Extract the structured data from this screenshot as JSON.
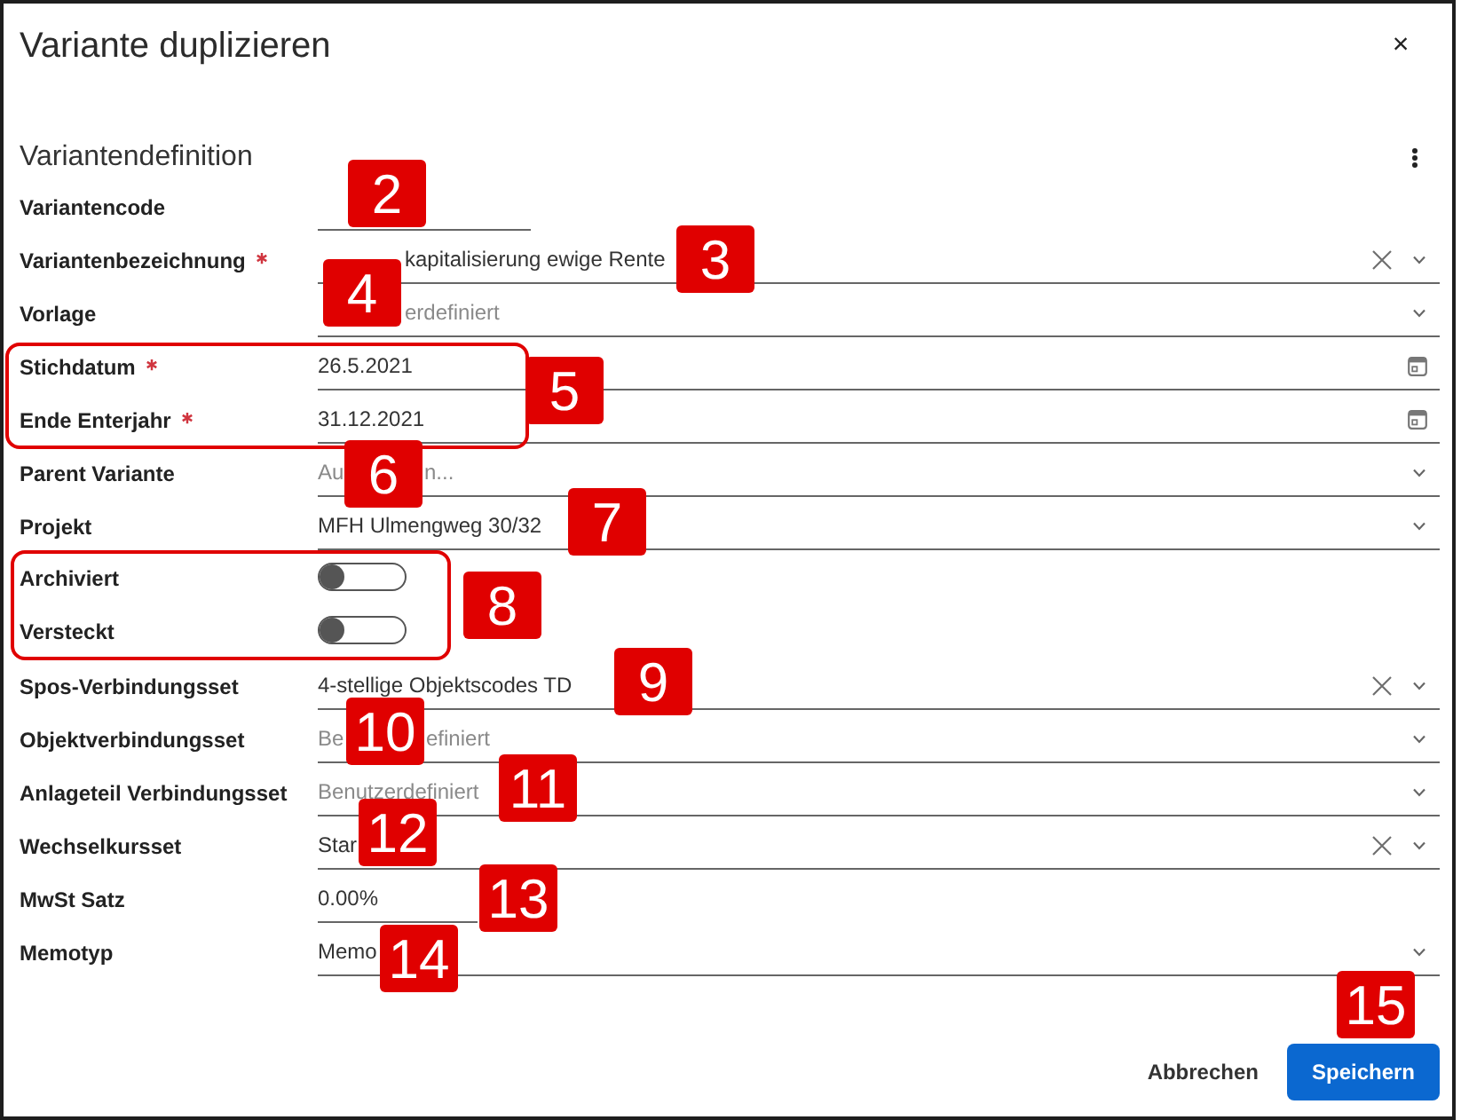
{
  "dialog": {
    "title": "Variante duplizieren",
    "close": "×"
  },
  "section": {
    "title": "Variantendefinition"
  },
  "fields": [
    {
      "kind": "short_input",
      "label": "Variantencode",
      "required": false
    },
    {
      "kind": "select",
      "label": "Variantenbezeichnung",
      "required": true,
      "value": "kapitalisierung ewige Rente",
      "clearable": true
    },
    {
      "kind": "select",
      "label": "Vorlage",
      "required": false,
      "placeholder": "erdefiniert",
      "clearable": false
    },
    {
      "kind": "group",
      "highlighted": true,
      "fields": [
        {
          "kind": "date",
          "label": "Stichdatum",
          "required": true,
          "value": "26.5.2021"
        },
        {
          "kind": "date",
          "label": "Ende Enterjahr",
          "required": true,
          "value": "31.12.2021"
        }
      ]
    },
    {
      "kind": "select",
      "label": "Parent Variante",
      "required": false,
      "placeholder": "Au",
      "placeholder_tail": "n...",
      "clearable": false
    },
    {
      "kind": "select",
      "label": "Projekt",
      "required": false,
      "value": "MFH Ulmengweg 30/32",
      "clearable": false
    },
    {
      "kind": "group",
      "highlighted": true,
      "fields": [
        {
          "kind": "toggle",
          "label": "Archiviert",
          "on": false
        },
        {
          "kind": "toggle",
          "label": "Versteckt",
          "on": false
        }
      ]
    },
    {
      "kind": "select",
      "label": "Spos-Verbindungsset",
      "required": false,
      "value": "4-stellige Objektscodes TD",
      "clearable": true
    },
    {
      "kind": "select",
      "label": "Objektverbindungsset",
      "required": false,
      "placeholder": "Be",
      "placeholder_tail": "efiniert",
      "clearable": false
    },
    {
      "kind": "select",
      "label": "Anlageteil Verbindungsset",
      "required": false,
      "placeholder": "Benutzerdefiniert",
      "clearable": false
    },
    {
      "kind": "select",
      "label": "Wechselkursset",
      "required": false,
      "value": "Star",
      "clearable": true
    },
    {
      "kind": "short_input",
      "label": "MwSt Satz",
      "required": false,
      "value": "0.00%"
    },
    {
      "kind": "select",
      "label": "Memotyp",
      "required": false,
      "value": "Memo",
      "clearable": false
    }
  ],
  "buttons": [
    {
      "kind": "secondary",
      "label": "Abbrechen"
    },
    {
      "kind": "primary",
      "label": "Speichern"
    }
  ],
  "callouts": [
    "2",
    "3",
    "4",
    "5",
    "6",
    "7",
    "8",
    "9",
    "10",
    "11",
    "12",
    "13",
    "14",
    "15"
  ]
}
